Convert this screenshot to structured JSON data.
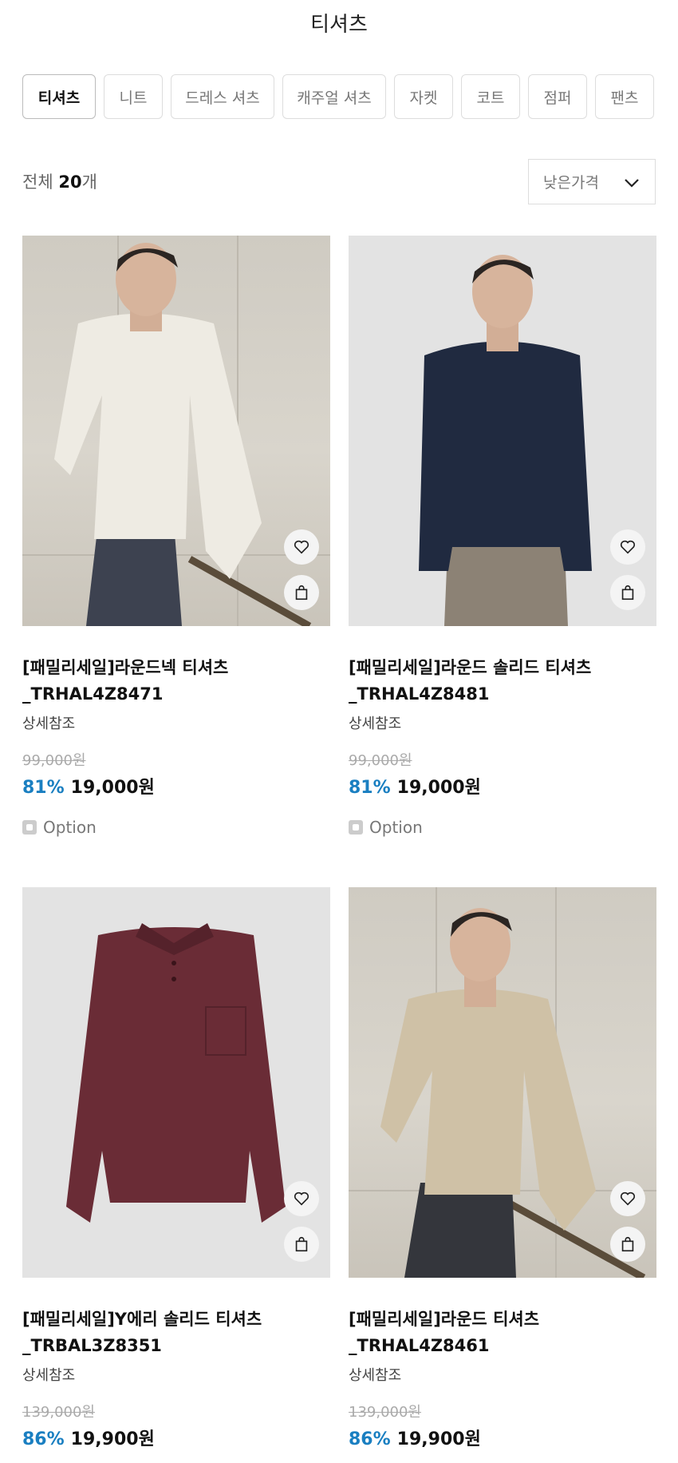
{
  "header": {
    "title": "티셔츠"
  },
  "tabs": [
    {
      "label": "티셔츠",
      "active": true
    },
    {
      "label": "니트"
    },
    {
      "label": "드레스 셔츠"
    },
    {
      "label": "캐주얼 셔츠"
    },
    {
      "label": "자켓"
    },
    {
      "label": "코트"
    },
    {
      "label": "점퍼"
    },
    {
      "label": "팬츠"
    }
  ],
  "summary": {
    "prefix": "전체",
    "count": "20",
    "suffix": "개"
  },
  "sort": {
    "selected": "낮은가격"
  },
  "colors": {
    "accent": "#1a7fc1"
  },
  "products": [
    {
      "name_line1": "[패밀리세일]라운드넥 티셔츠",
      "name_line2": "_TRHAL4Z8471",
      "subtitle": "상세참조",
      "original_price": "99,000원",
      "discount": "81%",
      "price": "19,000원",
      "option_label": "Option",
      "image": "model-white-tshirt"
    },
    {
      "name_line1": "[패밀리세일]라운드 솔리드 티셔츠",
      "name_line2": "_TRHAL4Z8481",
      "subtitle": "상세참조",
      "original_price": "99,000원",
      "discount": "81%",
      "price": "19,000원",
      "option_label": "Option",
      "image": "model-navy-tshirt"
    },
    {
      "name_line1": "[패밀리세일]Y에리 솔리드 티셔츠",
      "name_line2": "_TRBAL3Z8351",
      "subtitle": "상세참조",
      "original_price": "139,000원",
      "discount": "86%",
      "price": "19,900원",
      "image": "burgundy-polo-shirt"
    },
    {
      "name_line1": "[패밀리세일]라운드 티셔츠",
      "name_line2": "_TRHAL4Z8461",
      "subtitle": "상세참조",
      "original_price": "139,000원",
      "discount": "86%",
      "price": "19,900원",
      "image": "model-beige-tshirt"
    }
  ]
}
